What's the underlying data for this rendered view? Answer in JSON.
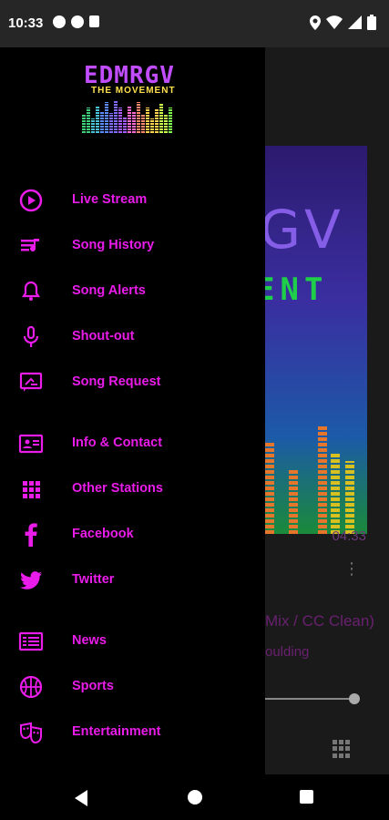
{
  "status": {
    "time": "10:33",
    "left_icons": [
      "record-icon",
      "f-icon",
      "sd-card-icon"
    ],
    "right_icons": [
      "location-icon",
      "wifi-icon",
      "signal-icon",
      "battery-icon"
    ]
  },
  "brand": {
    "logo_text": "EDMRGV",
    "logo_sub": "THE MOVEMENT",
    "accent": "#e91ce9"
  },
  "menu": {
    "items": [
      {
        "label": "Live Stream",
        "icon": "play-circle-icon"
      },
      {
        "label": "Song History",
        "icon": "playlist-icon"
      },
      {
        "label": "Song Alerts",
        "icon": "bell-icon"
      },
      {
        "label": "Shout-out",
        "icon": "microphone-icon"
      },
      {
        "label": "Song Request",
        "icon": "message-icon"
      },
      {
        "label": "Info & Contact",
        "icon": "contact-card-icon"
      },
      {
        "label": "Other Stations",
        "icon": "grid-icon"
      },
      {
        "label": "Facebook",
        "icon": "facebook-icon"
      },
      {
        "label": "Twitter",
        "icon": "twitter-icon"
      },
      {
        "label": "News",
        "icon": "news-icon"
      },
      {
        "label": "Sports",
        "icon": "basketball-icon"
      },
      {
        "label": "Entertainment",
        "icon": "theater-masks-icon"
      }
    ]
  },
  "player": {
    "art_title": "GV",
    "art_sub": "ENT",
    "duration": "04:33",
    "song_title": "Mix / CC Clean)",
    "artist": "oulding",
    "progress": 1.0
  }
}
